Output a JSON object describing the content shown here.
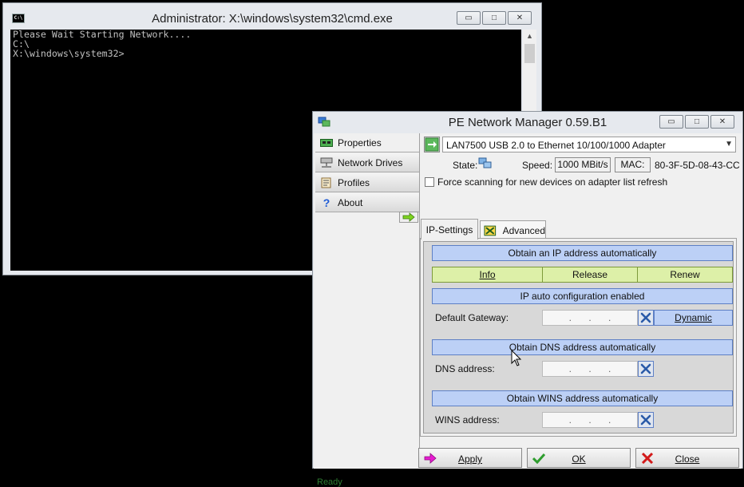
{
  "cmd": {
    "title": "Administrator: X:\\windows\\system32\\cmd.exe",
    "lines": [
      "Please Wait Starting Network....",
      "C:\\",
      "",
      "X:\\windows\\system32>"
    ]
  },
  "pe": {
    "title": "PE Network Manager 0.59.B1",
    "nav": [
      "Properties",
      "Network Drives",
      "Profiles",
      "About"
    ],
    "adapter": "LAN7500 USB 2.0 to Ethernet 10/100/1000 Adapter",
    "state_label": "State:",
    "speed_label": "Speed:",
    "speed_value": "1000 MBit/s",
    "mac_label": "MAC:",
    "mac_value": "80-3F-5D-08-43-CC",
    "force_scan_label": "Force scanning for new devices on adapter list refresh",
    "tabs": [
      "IP-Settings",
      "Advanced"
    ],
    "ip_auto_label": "Obtain an IP address automatically",
    "info_label": "Info",
    "release_label": "Release",
    "renew_label": "Renew",
    "ip_status": "IP auto configuration enabled",
    "gateway_label": "Default Gateway:",
    "dynamic_label": "Dynamic",
    "dns_auto_label": "Obtain DNS address automatically",
    "dns_label": "DNS address:",
    "wins_auto_label": "Obtain WINS address automatically",
    "wins_label": "WINS address:",
    "ip_dots": ".",
    "apply_label": "Apply",
    "ok_label": "OK",
    "close_label": "Close",
    "status": "Ready"
  },
  "colors": {
    "blue_bar": "#bcd0f6",
    "green_btn": "#ddf0a8",
    "status_text": "#2e7d32",
    "console_bg": "#000000",
    "console_text": "#c0c0c0"
  }
}
